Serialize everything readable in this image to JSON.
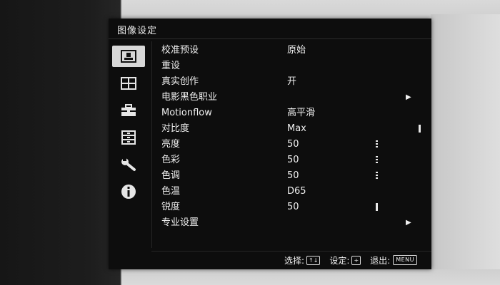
{
  "menu": {
    "title": "图像设定",
    "categories": [
      {
        "name": "picture",
        "icon": "picture-icon",
        "active": true
      },
      {
        "name": "screen",
        "icon": "screen-icon",
        "active": false
      },
      {
        "name": "setup",
        "icon": "toolbox-icon",
        "active": false
      },
      {
        "name": "function",
        "icon": "list-icon",
        "active": false
      },
      {
        "name": "installation",
        "icon": "wrench-icon",
        "active": false
      },
      {
        "name": "information",
        "icon": "info-icon",
        "active": false
      }
    ],
    "items": [
      {
        "label": "校准预设",
        "value": "原始"
      },
      {
        "label": "重设",
        "value": ""
      },
      {
        "label": "真实创作",
        "value": "开"
      },
      {
        "label": "电影黑色职业",
        "value": "",
        "submenu": "▶"
      },
      {
        "label": "Motionflow",
        "value": "高平滑"
      },
      {
        "label": "对比度",
        "value": "Max",
        "level": 1.0
      },
      {
        "label": "亮度",
        "value": "50",
        "level": 0.5
      },
      {
        "label": "色彩",
        "value": "50",
        "level": 0.5
      },
      {
        "label": "色调",
        "value": "50",
        "level": 0.5
      },
      {
        "label": "色温",
        "value": "D65"
      },
      {
        "label": "锐度",
        "value": "50",
        "level": 0.5
      },
      {
        "label": "专业设置",
        "value": "",
        "submenu": "▶"
      }
    ],
    "footer": {
      "select_label": "选择:",
      "select_keys": "↑↓",
      "set_label": "设定:",
      "set_key": "+",
      "exit_label": "退出:",
      "exit_key": "MENU"
    }
  }
}
